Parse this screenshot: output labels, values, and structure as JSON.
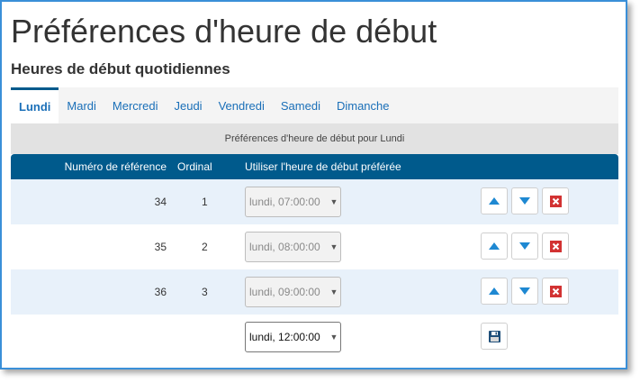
{
  "page": {
    "title": "Préférences d'heure de début",
    "section": "Heures de début quotidiennes"
  },
  "tabs": [
    {
      "label": "Lundi",
      "active": true
    },
    {
      "label": "Mardi",
      "active": false
    },
    {
      "label": "Mercredi",
      "active": false
    },
    {
      "label": "Jeudi",
      "active": false
    },
    {
      "label": "Vendredi",
      "active": false
    },
    {
      "label": "Samedi",
      "active": false
    },
    {
      "label": "Dimanche",
      "active": false
    }
  ],
  "table": {
    "caption": "Préférences d'heure de début pour Lundi",
    "headers": {
      "ref": "Numéro de référence",
      "ordinal": "Ordinal",
      "preferred": "Utiliser l'heure de début préférée"
    },
    "rows": [
      {
        "ref": "34",
        "ordinal": "1",
        "time": "lundi, 07:00:00"
      },
      {
        "ref": "35",
        "ordinal": "2",
        "time": "lundi, 08:00:00"
      },
      {
        "ref": "36",
        "ordinal": "3",
        "time": "lundi, 09:00:00"
      }
    ],
    "new_row": {
      "time": "lundi, 12:00:00"
    }
  },
  "colors": {
    "header_bg": "#005a8c",
    "link": "#1a6fb8",
    "arrow": "#1e88d2",
    "delete": "#d23232"
  },
  "icons": {
    "up": "arrow-up-icon",
    "down": "arrow-down-icon",
    "delete": "delete-icon",
    "save": "save-icon",
    "dropdown": "chevron-down-icon"
  }
}
